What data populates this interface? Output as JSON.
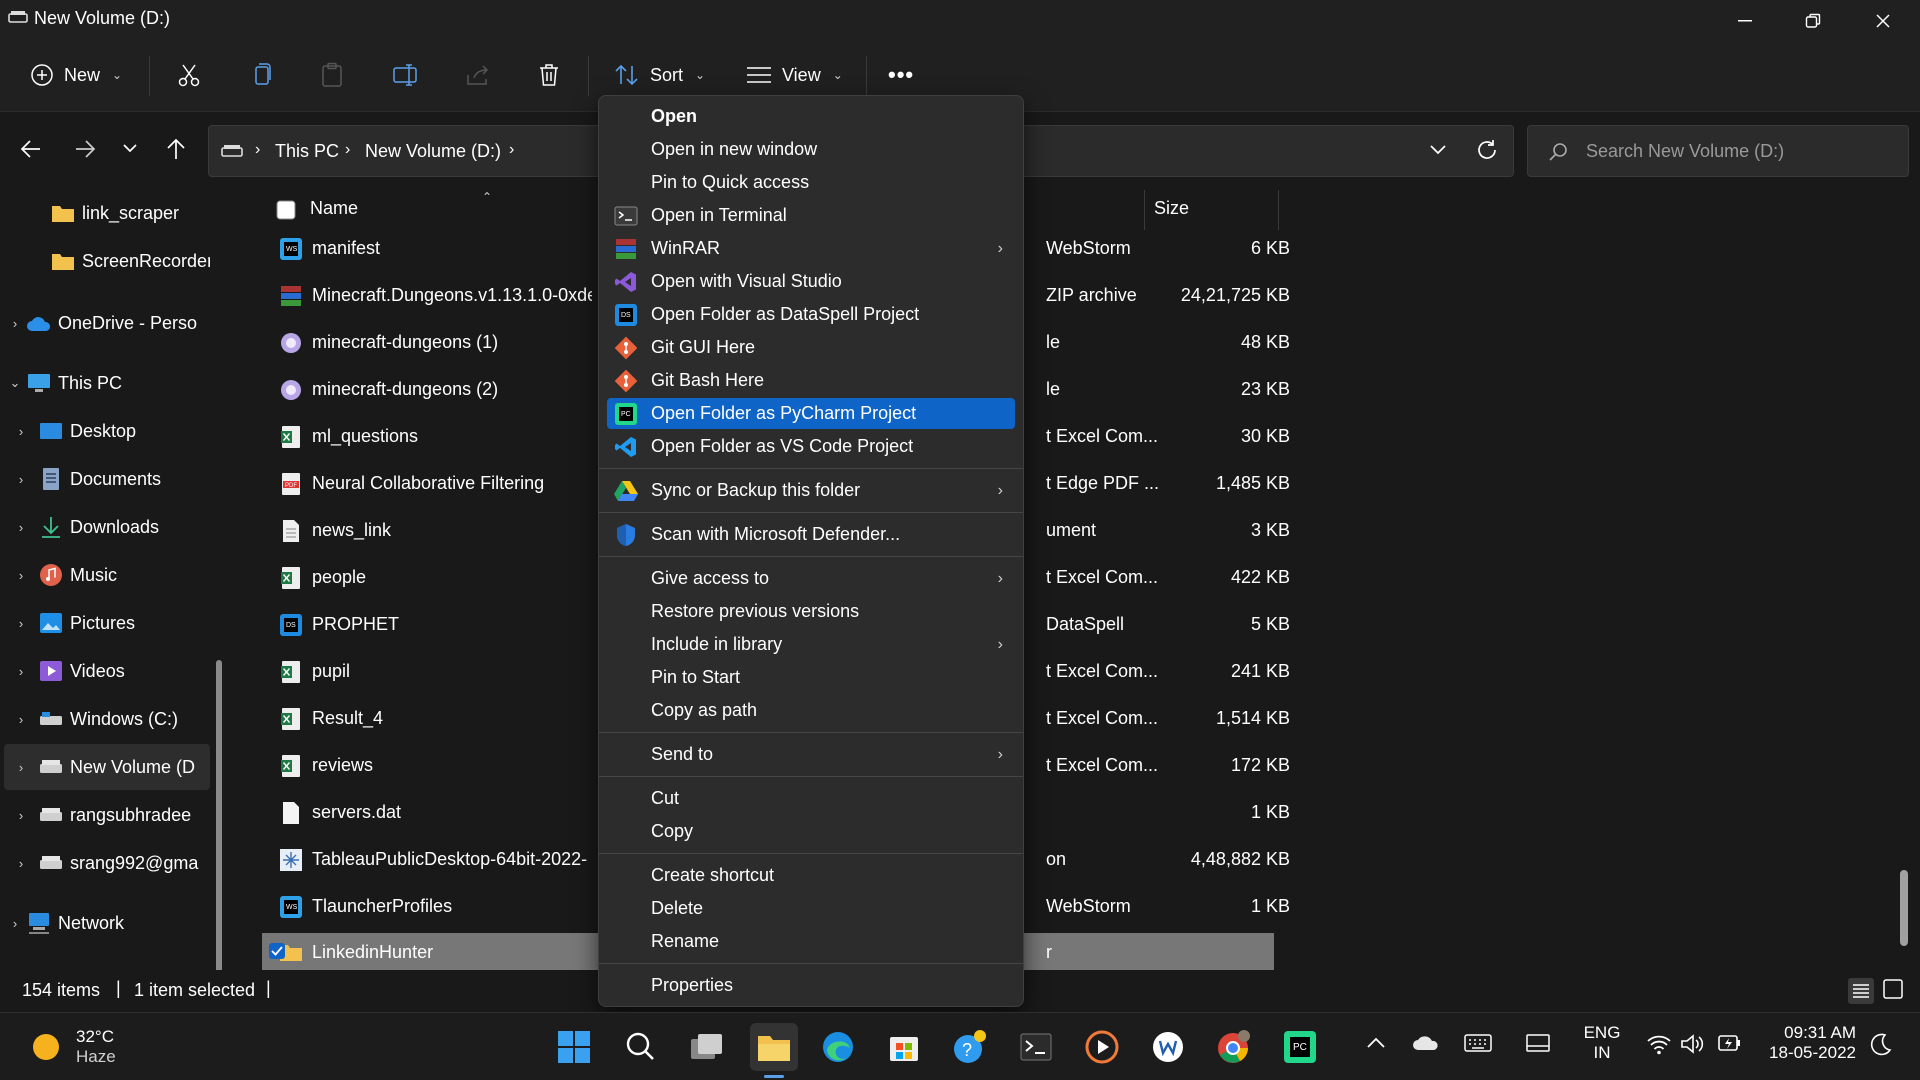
{
  "window": {
    "title": "New Volume (D:)"
  },
  "toolbar": {
    "new_label": "New",
    "sort_label": "Sort",
    "view_label": "View",
    "more_label": "•••"
  },
  "address": {
    "crumbs": [
      "This PC",
      "New Volume (D:)"
    ],
    "search_placeholder": "Search New Volume (D:)"
  },
  "sidebar": {
    "items": [
      {
        "label": "link_scraper",
        "icon": "folder-icon"
      },
      {
        "label": "ScreenRecorder",
        "icon": "folder-icon"
      },
      {
        "label": "OneDrive - Perso",
        "icon": "cloud-icon"
      },
      {
        "label": "This PC",
        "icon": "pc-icon"
      },
      {
        "label": "Desktop",
        "icon": "desktop-icon"
      },
      {
        "label": "Documents",
        "icon": "documents-icon"
      },
      {
        "label": "Downloads",
        "icon": "download-icon"
      },
      {
        "label": "Music",
        "icon": "music-icon"
      },
      {
        "label": "Pictures",
        "icon": "pictures-icon"
      },
      {
        "label": "Videos",
        "icon": "videos-icon"
      },
      {
        "label": "Windows (C:)",
        "icon": "drive-icon"
      },
      {
        "label": "New Volume (D",
        "icon": "drive-icon"
      },
      {
        "label": "rangsubhradee",
        "icon": "network-drive-icon"
      },
      {
        "label": "srang992@gma",
        "icon": "network-drive-icon"
      },
      {
        "label": "Network",
        "icon": "network-icon"
      }
    ]
  },
  "filelist": {
    "col_name": "Name",
    "col_size": "Size",
    "rows": [
      {
        "name": "manifest",
        "type": "WebStorm",
        "size": "6 KB",
        "icon": "webstorm-icon"
      },
      {
        "name": "Minecraft.Dungeons.v1.13.1.0-0xde",
        "type": "ZIP archive",
        "size": "24,21,725 KB",
        "icon": "winrar-icon"
      },
      {
        "name": "minecraft-dungeons (1)",
        "type": "le",
        "size": "48 KB",
        "icon": "torrent-icon"
      },
      {
        "name": "minecraft-dungeons (2)",
        "type": "le",
        "size": "23 KB",
        "icon": "torrent-icon"
      },
      {
        "name": "ml_questions",
        "type": "t Excel Com...",
        "size": "30 KB",
        "icon": "excel-icon"
      },
      {
        "name": "Neural Collaborative Filtering",
        "type": "t Edge PDF ...",
        "size": "1,485 KB",
        "icon": "pdf-icon"
      },
      {
        "name": "news_link",
        "type": "ument",
        "size": "3 KB",
        "icon": "document-icon"
      },
      {
        "name": "people",
        "type": "t Excel Com...",
        "size": "422 KB",
        "icon": "excel-icon"
      },
      {
        "name": "PROPHET",
        "type": "DataSpell",
        "size": "5 KB",
        "icon": "dataspell-icon"
      },
      {
        "name": "pupil",
        "type": "t Excel Com...",
        "size": "241 KB",
        "icon": "excel-icon"
      },
      {
        "name": "Result_4",
        "type": "t Excel Com...",
        "size": "1,514 KB",
        "icon": "excel-icon"
      },
      {
        "name": "reviews",
        "type": "t Excel Com...",
        "size": "172 KB",
        "icon": "excel-icon"
      },
      {
        "name": "servers.dat",
        "type": "",
        "size": "1 KB",
        "icon": "file-icon"
      },
      {
        "name": "TableauPublicDesktop-64bit-2022-",
        "type": "on",
        "size": "4,48,882 KB",
        "icon": "tableau-icon"
      },
      {
        "name": "TlauncherProfiles",
        "type": "WebStorm",
        "size": "1 KB",
        "icon": "webstorm-icon"
      },
      {
        "name": "LinkedinHunter",
        "type": "r",
        "size": "",
        "icon": "folder-icon"
      }
    ]
  },
  "status": {
    "items_count": "154 items",
    "selected": "1 item selected"
  },
  "context_menu": {
    "groups": [
      [
        {
          "label": "Open",
          "icon": "",
          "bold": true
        },
        {
          "label": "Open in new window",
          "icon": ""
        },
        {
          "label": "Pin to Quick access",
          "icon": ""
        },
        {
          "label": "Open in Terminal",
          "icon": "terminal-icon"
        },
        {
          "label": "WinRAR",
          "icon": "winrar-icon",
          "submenu": true
        },
        {
          "label": "Open with Visual Studio",
          "icon": "visual-studio-icon"
        },
        {
          "label": "Open Folder as DataSpell Project",
          "icon": "dataspell-icon"
        },
        {
          "label": "Git GUI Here",
          "icon": "git-icon"
        },
        {
          "label": "Git Bash Here",
          "icon": "git-icon"
        },
        {
          "label": "Open Folder as PyCharm Project",
          "icon": "pycharm-icon",
          "highlight": true
        },
        {
          "label": "Open Folder as VS Code Project",
          "icon": "vscode-icon"
        }
      ],
      [
        {
          "label": "Sync or Backup this folder",
          "icon": "google-drive-icon",
          "submenu": true
        }
      ],
      [
        {
          "label": "Scan with Microsoft Defender...",
          "icon": "defender-shield-icon"
        }
      ],
      [
        {
          "label": "Give access to",
          "icon": "",
          "submenu": true
        },
        {
          "label": "Restore previous versions",
          "icon": ""
        },
        {
          "label": "Include in library",
          "icon": "",
          "submenu": true
        },
        {
          "label": "Pin to Start",
          "icon": ""
        },
        {
          "label": "Copy as path",
          "icon": ""
        }
      ],
      [
        {
          "label": "Send to",
          "icon": "",
          "submenu": true
        }
      ],
      [
        {
          "label": "Cut",
          "icon": ""
        },
        {
          "label": "Copy",
          "icon": ""
        }
      ],
      [
        {
          "label": "Create shortcut",
          "icon": ""
        },
        {
          "label": "Delete",
          "icon": ""
        },
        {
          "label": "Rename",
          "icon": ""
        }
      ],
      [
        {
          "label": "Properties",
          "icon": ""
        }
      ]
    ]
  },
  "taskbar": {
    "weather_temp": "32°C",
    "weather_desc": "Haze",
    "lang_top": "ENG",
    "lang_bottom": "IN",
    "time": "09:31 AM",
    "date": "18-05-2022"
  },
  "colors": {
    "highlight": "#0f64c8",
    "folder": "#f2c14e",
    "selected_row": "#777777"
  }
}
